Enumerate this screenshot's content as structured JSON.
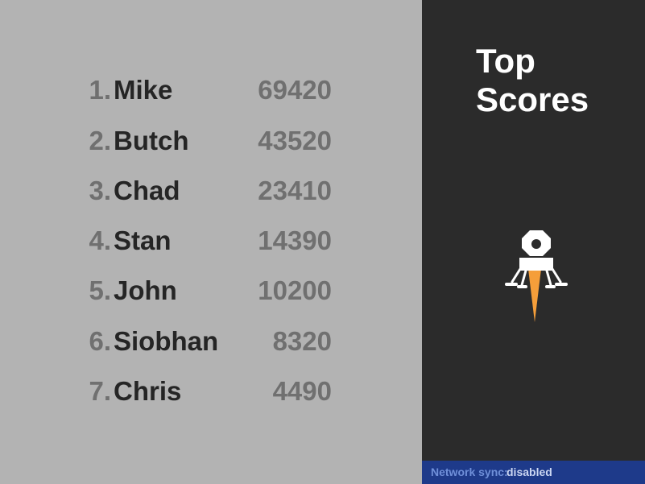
{
  "title_line1": "Top",
  "title_line2": "Scores",
  "scores": [
    {
      "rank": "1.",
      "name": "Mike",
      "score": "69420"
    },
    {
      "rank": "2.",
      "name": "Butch",
      "score": "43520"
    },
    {
      "rank": "3.",
      "name": "Chad",
      "score": "23410"
    },
    {
      "rank": "4.",
      "name": "Stan",
      "score": "14390"
    },
    {
      "rank": "5.",
      "name": "John",
      "score": "10200"
    },
    {
      "rank": "6.",
      "name": "Siobhan",
      "score": "8320"
    },
    {
      "rank": "7.",
      "name": "Chris",
      "score": "4490"
    }
  ],
  "status": {
    "label": "Network sync:",
    "value": "disabled"
  },
  "colors": {
    "left_bg": "#b3b3b3",
    "right_bg": "#2b2b2b",
    "status_bg": "#1e3a8a",
    "flame": "#f59e3a"
  },
  "icons": {
    "lander": "lunar-lander-icon"
  }
}
